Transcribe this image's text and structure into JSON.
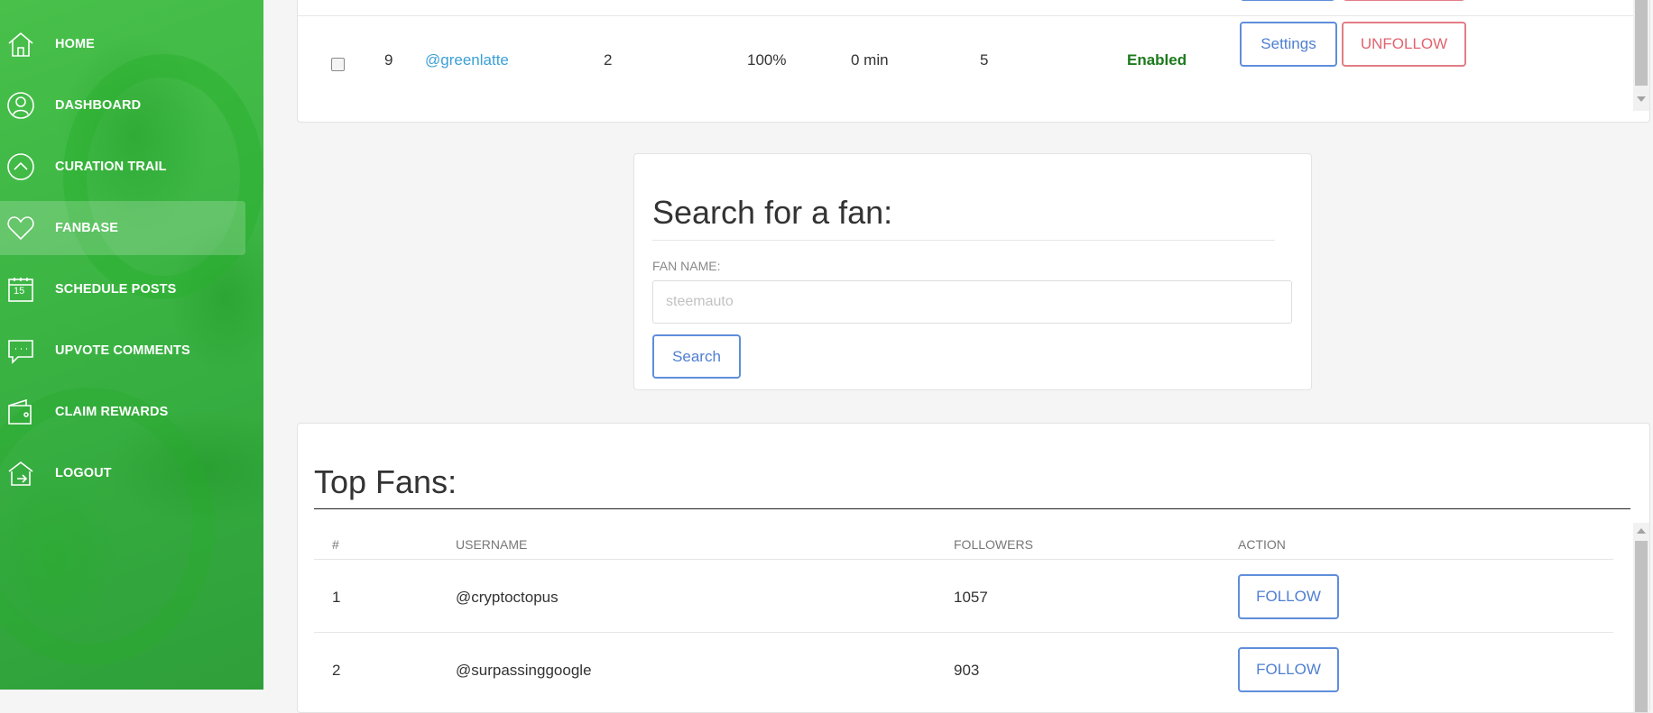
{
  "sidebar": {
    "items": [
      {
        "label": "HOME",
        "icon": "home-icon"
      },
      {
        "label": "DASHBOARD",
        "icon": "user-icon"
      },
      {
        "label": "CURATION TRAIL",
        "icon": "chevron-up-icon"
      },
      {
        "label": "FANBASE",
        "icon": "heart-icon",
        "active": true
      },
      {
        "label": "SCHEDULE POSTS",
        "icon": "calendar-icon",
        "calendar_day": "15"
      },
      {
        "label": "UPVOTE COMMENTS",
        "icon": "comment-icon"
      },
      {
        "label": "CLAIM REWARDS",
        "icon": "wallet-icon"
      },
      {
        "label": "LOGOUT",
        "icon": "logout-icon"
      }
    ]
  },
  "followed_table": {
    "row": {
      "index": "9",
      "username": "@greenlatte",
      "col3": "2",
      "weight": "100%",
      "delay": "0 min",
      "col6": "5",
      "status": "Enabled",
      "settings_label": "Settings",
      "unfollow_label": "UNFOLLOW"
    }
  },
  "search": {
    "title": "Search for a fan:",
    "field_label": "FAN NAME:",
    "placeholder": "steemauto",
    "button_label": "Search"
  },
  "top_fans": {
    "title": "Top Fans:",
    "headers": {
      "index": "#",
      "username": "USERNAME",
      "followers": "FOLLOWERS",
      "action": "ACTION"
    },
    "rows": [
      {
        "index": "1",
        "username": "@cryptoctopus",
        "followers": "1057",
        "action": "FOLLOW"
      },
      {
        "index": "2",
        "username": "@surpassinggoogle",
        "followers": "903",
        "action": "FOLLOW"
      }
    ]
  },
  "colors": {
    "sidebar_green": "#3cb544",
    "link_blue": "#3aa0d6",
    "button_blue": "#5f8edb",
    "button_red": "#e27d86",
    "enabled_green": "#1c7a1c"
  }
}
